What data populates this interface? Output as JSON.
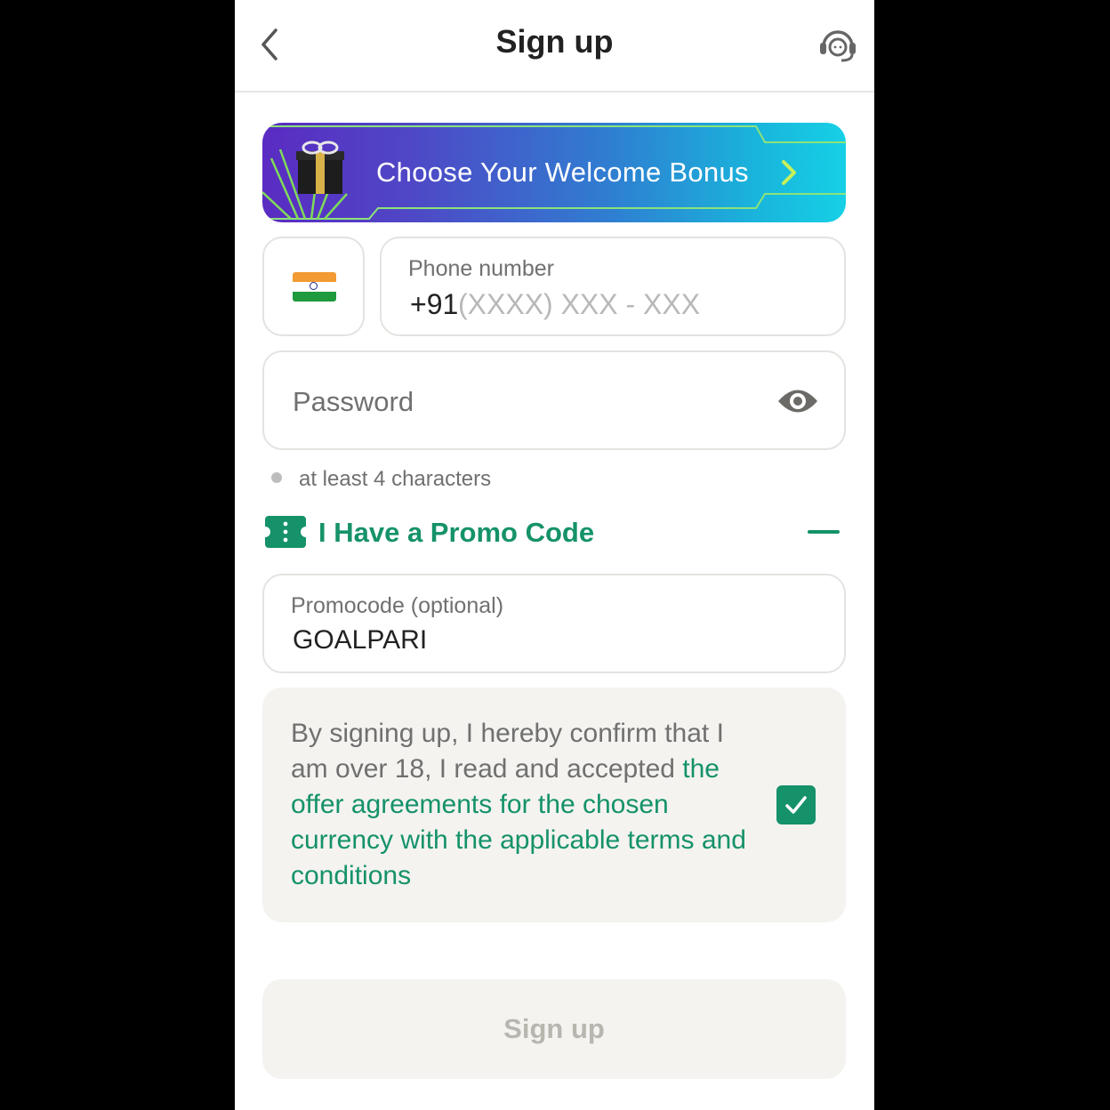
{
  "header": {
    "title": "Sign up",
    "back_icon": "chevron-left-icon",
    "support_icon": "headset-support-icon"
  },
  "banner": {
    "text": "Choose Your Welcome Bonus",
    "icon": "gift-box-icon",
    "chevron": "chevron-right-icon"
  },
  "country": {
    "flag": "india-flag-icon"
  },
  "phone": {
    "label": "Phone number",
    "prefix": "+91",
    "placeholder": "(XXXX) XXX - XXX"
  },
  "password": {
    "placeholder": "Password",
    "toggle_icon": "eye-icon",
    "hint": "at least 4 characters"
  },
  "promo": {
    "toggle_label": "I Have a Promo Code",
    "toggle_icon": "ticket-icon",
    "collapse_icon": "minus-icon",
    "field_label": "Promocode (optional)",
    "value": "GOALPARI"
  },
  "terms": {
    "text_plain": "By signing up, I hereby confirm that I am over 18, I read and accepted ",
    "text_link": "the offer agreements for the chosen currency with the applicable terms and conditions",
    "checked": true
  },
  "submit": {
    "label": "Sign up"
  },
  "colors": {
    "accent": "#15926a",
    "muted_text": "#707070",
    "field_border": "#e3e3e0",
    "panel_bg": "#f4f3f0",
    "disabled_text": "#b9b6b0"
  }
}
